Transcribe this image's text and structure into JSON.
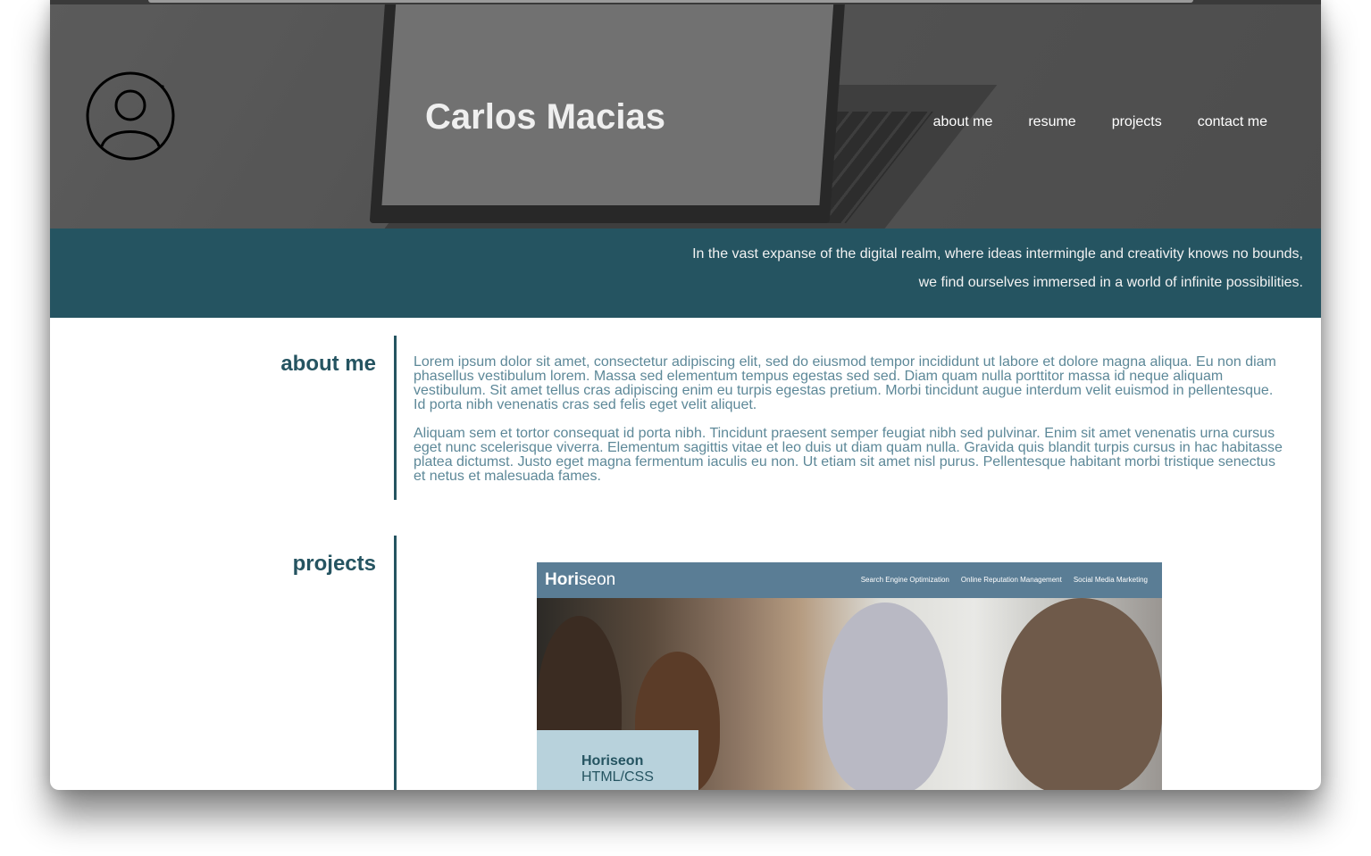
{
  "header": {
    "title": "Carlos Macias",
    "nav": [
      "about me",
      "resume",
      "projects",
      "contact me"
    ]
  },
  "banner": {
    "line1": "In the vast expanse of the digital realm, where ideas intermingle and creativity knows no bounds,",
    "line2": "we find ourselves immersed in a world of infinite possibilities."
  },
  "about": {
    "heading": "about me",
    "paragraphs": [
      "Lorem ipsum dolor sit amet, consectetur adipiscing elit, sed do eiusmod tempor incididunt ut labore et dolore magna aliqua. Eu non diam phasellus vestibulum lorem. Massa sed elementum tempus egestas sed sed. Diam quam nulla porttitor massa id neque aliquam vestibulum. Sit amet tellus cras adipiscing enim eu turpis egestas pretium. Morbi tincidunt augue interdum velit euismod in pellentesque. Id porta nibh venenatis cras sed felis eget velit aliquet.",
      "Aliquam sem et tortor consequat id porta nibh. Tincidunt praesent semper feugiat nibh sed pulvinar. Enim sit amet venenatis urna cursus eget nunc scelerisque viverra. Elementum sagittis vitae et leo duis ut diam quam nulla. Gravida quis blandit turpis cursus in hac habitasse platea dictumst. Justo eget magna fermentum iaculis eu non. Ut etiam sit amet nisl purus. Pellentesque habitant morbi tristique senectus et netus et malesuada fames."
    ]
  },
  "projects": {
    "heading": "projects",
    "card": {
      "logo_a": "Hori",
      "logo_b": "seon",
      "nav": [
        "Search Engine Optimization",
        "Online Reputation Management",
        "Social Media Marketing"
      ],
      "name": "Horiseon",
      "tech": "HTML/CSS"
    }
  },
  "colors": {
    "accent": "#255461",
    "body_text": "#5d8898",
    "card_header": "#5a7d95",
    "card_label": "#b8d2dc"
  },
  "icons": [
    "user-avatar-icon"
  ]
}
